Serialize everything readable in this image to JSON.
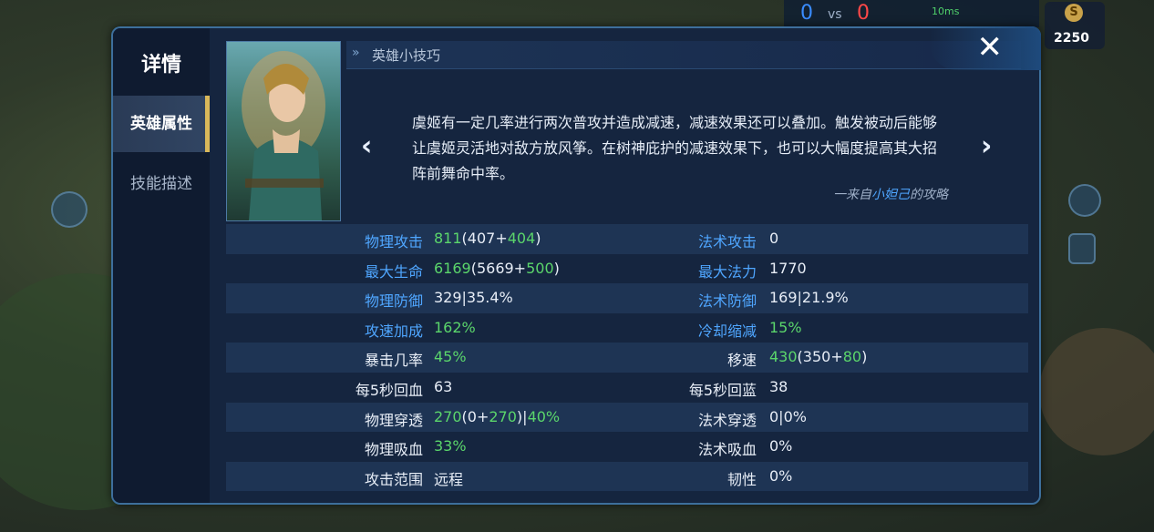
{
  "hud": {
    "score_left": "0",
    "vs": "vs",
    "score_right": "0",
    "ping": "10ms",
    "gold": "2250",
    "gold_icon": "S"
  },
  "panel": {
    "title": "详情",
    "tabs": [
      {
        "label": "英雄属性",
        "active": true
      },
      {
        "label": "技能描述",
        "active": false
      }
    ],
    "tips_label": "英雄小技巧",
    "close_icon": "✕",
    "prev_icon": "‹",
    "next_icon": "›",
    "tip_text": "虞姬有一定几率进行两次普攻并造成减速，减速效果还可以叠加。触发被动后能够让虞姬灵活地对敌方放风筝。在树神庇护的减速效果下，也可以大幅度提高其大招阵前舞命中率。",
    "tip_source_prefix": "一来自",
    "tip_source_author": "小妲己",
    "tip_source_suffix": "的攻略"
  },
  "stats": [
    {
      "left": {
        "label": "物理攻击",
        "label_color": "blue",
        "parts": [
          {
            "t": "811",
            "c": "green"
          },
          {
            "t": "(407+",
            "c": "white"
          },
          {
            "t": "404",
            "c": "green"
          },
          {
            "t": ")",
            "c": "white"
          }
        ]
      },
      "right": {
        "label": "法术攻击",
        "label_color": "blue",
        "parts": [
          {
            "t": "0",
            "c": "white"
          }
        ]
      }
    },
    {
      "left": {
        "label": "最大生命",
        "label_color": "blue",
        "parts": [
          {
            "t": "6169",
            "c": "green"
          },
          {
            "t": "(5669+",
            "c": "white"
          },
          {
            "t": "500",
            "c": "green"
          },
          {
            "t": ")",
            "c": "white"
          }
        ]
      },
      "right": {
        "label": "最大法力",
        "label_color": "blue",
        "parts": [
          {
            "t": "1770",
            "c": "white"
          }
        ]
      }
    },
    {
      "left": {
        "label": "物理防御",
        "label_color": "blue",
        "parts": [
          {
            "t": "329|35.4%",
            "c": "white"
          }
        ]
      },
      "right": {
        "label": "法术防御",
        "label_color": "blue",
        "parts": [
          {
            "t": "169|21.9%",
            "c": "white"
          }
        ]
      }
    },
    {
      "left": {
        "label": "攻速加成",
        "label_color": "blue",
        "parts": [
          {
            "t": "162%",
            "c": "green"
          }
        ]
      },
      "right": {
        "label": "冷却缩减",
        "label_color": "blue",
        "parts": [
          {
            "t": "15%",
            "c": "green"
          }
        ]
      }
    },
    {
      "left": {
        "label": "暴击几率",
        "label_color": "white",
        "parts": [
          {
            "t": "45%",
            "c": "green"
          }
        ]
      },
      "right": {
        "label": "移速",
        "label_color": "white",
        "parts": [
          {
            "t": "430",
            "c": "green"
          },
          {
            "t": "(350+",
            "c": "white"
          },
          {
            "t": "80",
            "c": "green"
          },
          {
            "t": ")",
            "c": "white"
          }
        ]
      }
    },
    {
      "left": {
        "label": "每5秒回血",
        "label_color": "white",
        "parts": [
          {
            "t": "63",
            "c": "white"
          }
        ]
      },
      "right": {
        "label": "每5秒回蓝",
        "label_color": "white",
        "parts": [
          {
            "t": "38",
            "c": "white"
          }
        ]
      }
    },
    {
      "left": {
        "label": "物理穿透",
        "label_color": "white",
        "parts": [
          {
            "t": "270",
            "c": "green"
          },
          {
            "t": "(0+",
            "c": "white"
          },
          {
            "t": "270",
            "c": "green"
          },
          {
            "t": ")|",
            "c": "white"
          },
          {
            "t": "40%",
            "c": "green"
          }
        ]
      },
      "right": {
        "label": "法术穿透",
        "label_color": "white",
        "parts": [
          {
            "t": "0|0%",
            "c": "white"
          }
        ]
      }
    },
    {
      "left": {
        "label": "物理吸血",
        "label_color": "white",
        "parts": [
          {
            "t": "33%",
            "c": "green"
          }
        ]
      },
      "right": {
        "label": "法术吸血",
        "label_color": "white",
        "parts": [
          {
            "t": "0%",
            "c": "white"
          }
        ]
      }
    },
    {
      "left": {
        "label": "攻击范围",
        "label_color": "white",
        "parts": [
          {
            "t": "远程",
            "c": "white"
          }
        ]
      },
      "right": {
        "label": "韧性",
        "label_color": "white",
        "parts": [
          {
            "t": "0%",
            "c": "white"
          }
        ]
      }
    }
  ],
  "colors": {
    "label_blue": "#4fa6ff",
    "value_green": "#5bd66b",
    "panel_bg": "#15253f",
    "accent_gold": "#d9b85a"
  }
}
